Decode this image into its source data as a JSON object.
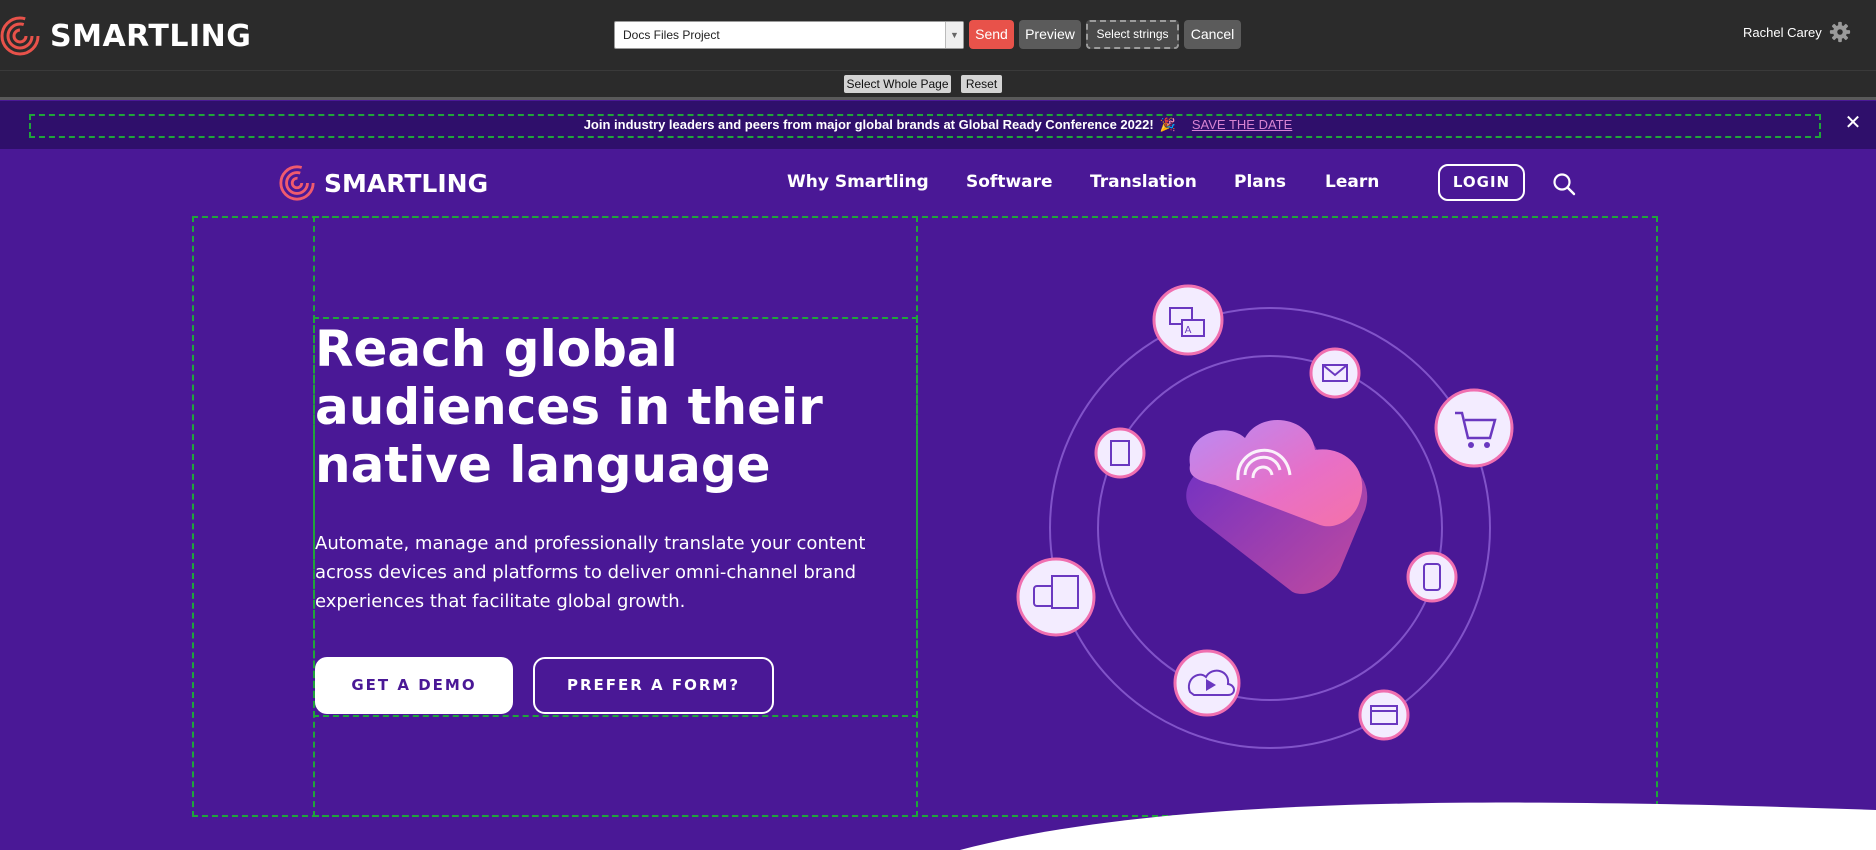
{
  "toolbar": {
    "logo_text": "SMARTLING",
    "project_select_value": "Docs Files Project",
    "send_label": "Send",
    "preview_label": "Preview",
    "select_strings_label": "Select strings",
    "cancel_label": "Cancel",
    "user_name": "Rachel Carey",
    "icons": {
      "logo": "fingerprint-logo-icon",
      "settings": "gear-icon",
      "dropdown": "chevron-down-icon"
    },
    "colors": {
      "background": "#2b2b2b",
      "send": "#e8524a"
    }
  },
  "selection_bar": {
    "select_whole_page_label": "Select Whole Page",
    "reset_label": "Reset"
  },
  "banner": {
    "text": "Join industry leaders and peers from major global brands at Global Ready Conference 2022!",
    "emoji": "🎉",
    "link_text": "SAVE THE DATE",
    "close_icon": "close-icon"
  },
  "site_nav": {
    "logo_text": "SMARTLING",
    "items": [
      "Why Smartling",
      "Software",
      "Translation",
      "Plans",
      "Learn"
    ],
    "login_label": "LOGIN",
    "search_icon": "search-icon"
  },
  "hero": {
    "title": "Reach global audiences in their native language",
    "subtitle": "Automate, manage and professionally translate your content across devices and platforms to deliver omni-channel brand experiences that facilitate global growth.",
    "primary_cta": "GET A DEMO",
    "secondary_cta": "PREFER A FORM?",
    "illustration_icons": [
      "translation-window-icon",
      "email-icon",
      "document-icon",
      "shopping-cart-icon",
      "mobile-app-icon",
      "chat-message-icon",
      "cloud-video-icon",
      "web-browser-icon",
      "cloud-fingerprint-icon"
    ],
    "colors": {
      "background": "#4a1896",
      "accent": "#f06fb0"
    }
  }
}
